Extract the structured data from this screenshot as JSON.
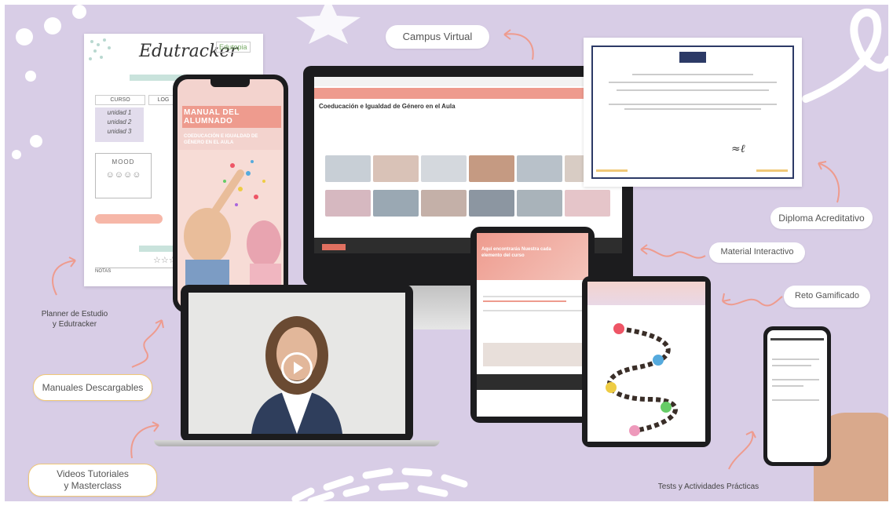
{
  "labels": {
    "campus_virtual": "Campus Virtual",
    "diploma": "Diploma Acreditativo",
    "material": "Material Interactivo",
    "reto": "Reto Gamificado",
    "planner": "Planner de Estudio\ny Edutracker",
    "manuales": "Manuales Descargables",
    "videos": "Videos Tutoriales\ny Masterclass",
    "tests": "Tests y Actividades Prácticas"
  },
  "planner": {
    "logo": "Edutracker",
    "brand": "Edutopia",
    "col1": "CURSO",
    "col2": "LOG",
    "rows": [
      "unidad 1",
      "unidad 2",
      "unidad 3"
    ],
    "mood": "MOOD",
    "notes": "NOTAS"
  },
  "phone_manual": {
    "title": "MANUAL DEL ALUMNADO",
    "subtitle": "COEDUCACIÓN E IGUALDAD DE GÉNERO EN EL AULA"
  },
  "monitor": {
    "course_title": "Coeducación e Igualdad de Género en el Aula"
  },
  "tablet": {
    "heading": "Aquí encontrarás Nuestra cada elemento del curso"
  },
  "colors": {
    "background": "#d8cde6",
    "accent": "#ee9b8e",
    "pill_border": "#f0c878"
  }
}
